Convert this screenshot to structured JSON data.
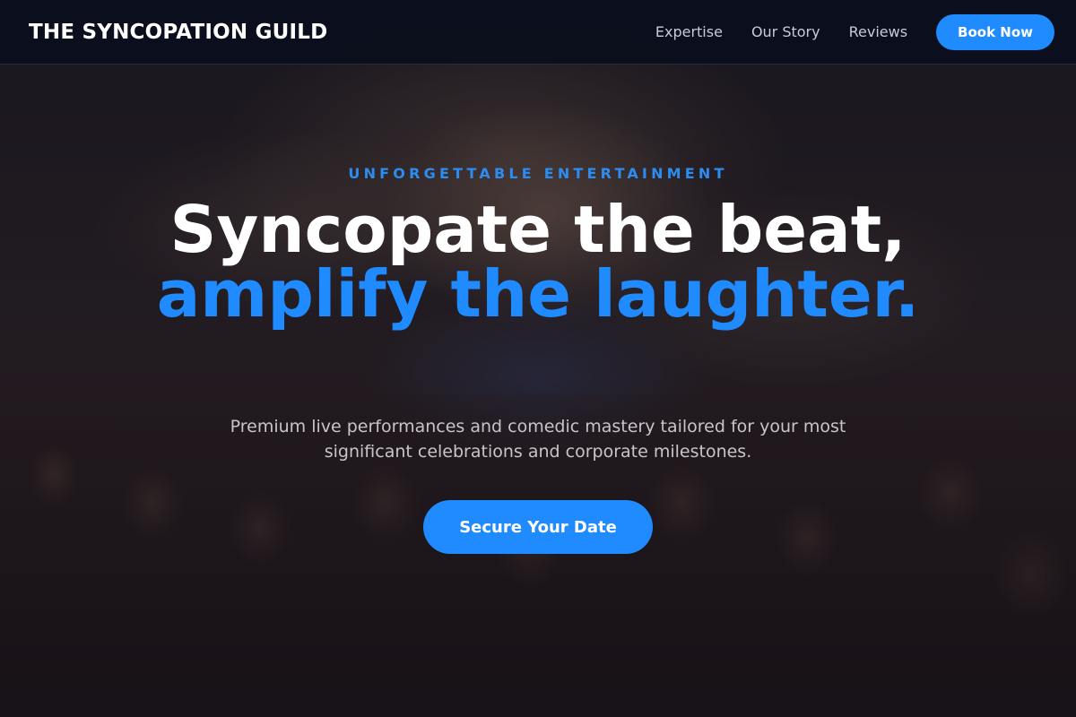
{
  "navbar": {
    "brand": "THE SYNCOPATION GUILD",
    "links": [
      "Expertise",
      "Our Story",
      "Reviews"
    ],
    "cta": "Book Now"
  },
  "hero": {
    "eyebrow": "UNFORGETTABLE ENTERTAINMENT",
    "headline_line1": "Syncopate the beat,",
    "headline_accent": "amplify the laughter.",
    "subtext": "Premium live performances and comedic mastery tailored for your most significant celebrations and corporate milestones.",
    "cta": "Secure Your Date"
  },
  "colors": {
    "accent": "#1f8bff",
    "navbar_bg": "#0a0e1c",
    "text_light": "#ffffff",
    "text_muted": "#c9c4c8"
  }
}
